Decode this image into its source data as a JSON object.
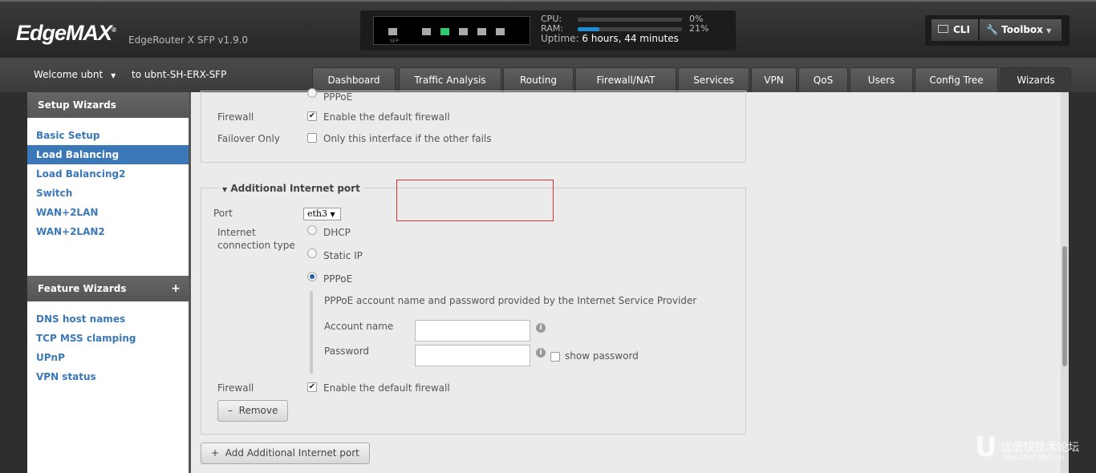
{
  "header": {
    "logo": "EdgeMAX",
    "model": "EdgeRouter X SFP v1.9.0",
    "ports": {
      "sfp_label": "SFP",
      "active_color": "#2ecc71"
    },
    "cpu_label": "CPU:",
    "cpu_percent": 0,
    "cpu_text": "0%",
    "ram_label": "RAM:",
    "ram_percent": 21,
    "ram_text": "21%",
    "uptime_label": "Uptime:",
    "uptime_value": "6 hours, 44 minutes",
    "cli_label": "CLI",
    "toolbox_label": "Toolbox"
  },
  "nav": {
    "welcome": "Welcome ubnt",
    "host": "to ubnt-SH-ERX-SFP",
    "tabs": [
      "Dashboard",
      "Traffic Analysis",
      "Routing",
      "Firewall/NAT",
      "Services",
      "VPN",
      "QoS",
      "Users",
      "Config Tree",
      "Wizards"
    ],
    "active_tab": "Wizards"
  },
  "sidebar": {
    "setup_title": "Setup Wizards",
    "setup_items": [
      "Basic Setup",
      "Load Balancing",
      "Load Balancing2",
      "Switch",
      "WAN+2LAN",
      "WAN+2LAN2"
    ],
    "active": "Load Balancing",
    "feature_title": "Feature Wizards",
    "feature_items": [
      "DNS host names",
      "TCP MSS clamping",
      "UPnP",
      "VPN status"
    ]
  },
  "main": {
    "prev": {
      "pppoe": "PPPoE",
      "firewall_label": "Firewall",
      "firewall_text": "Enable the default firewall",
      "failover_label": "Failover Only",
      "failover_text": "Only this interface if the other fails"
    },
    "additional": {
      "title": "Additional Internet port",
      "port_label": "Port",
      "port_value": "eth3",
      "conn_label": "Internet connection type",
      "dhcp": "DHCP",
      "static": "Static IP",
      "pppoe": "PPPoE",
      "pppoe_desc": "PPPoE account name and password provided by the Internet Service Provider",
      "account_label": "Account name",
      "account_value": "",
      "password_label": "Password",
      "password_value": "",
      "show_password": "show password",
      "firewall_label": "Firewall",
      "firewall_text": "Enable the default firewall",
      "remove": "Remove"
    },
    "add_button": "Add Additional Internet port"
  },
  "watermark": {
    "cn": "优倍快技术论坛",
    "url": "bbs.ubnt.com.cn"
  }
}
